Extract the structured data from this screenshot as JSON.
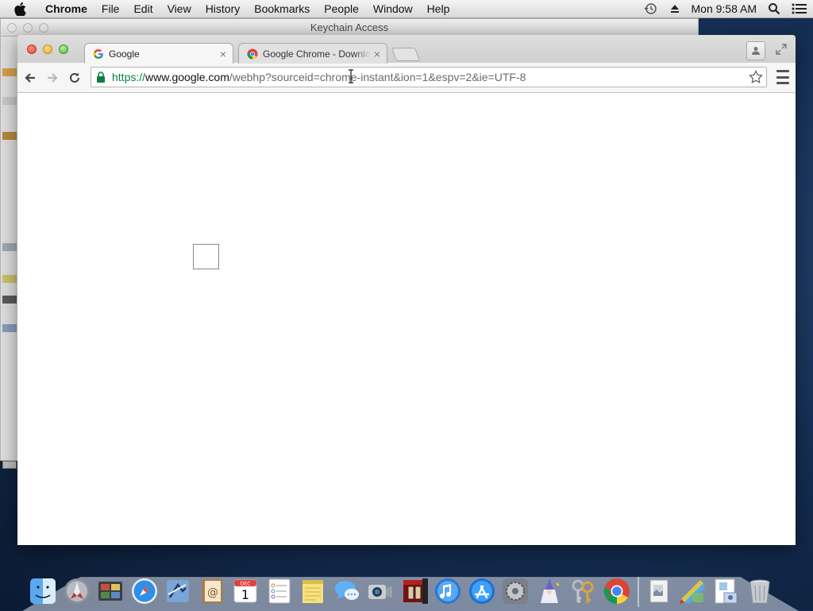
{
  "menubar": {
    "app_name": "Chrome",
    "items": [
      "File",
      "Edit",
      "View",
      "History",
      "Bookmarks",
      "People",
      "Window",
      "Help"
    ],
    "clock": "Mon 9:58 AM"
  },
  "background_window": {
    "title": "Keychain Access"
  },
  "browser": {
    "tabs": [
      {
        "title": "Google",
        "favicon": "google-favicon",
        "active": true
      },
      {
        "title": "Google Chrome - Download",
        "favicon": "chrome-favicon",
        "active": false
      }
    ],
    "tab_close_glyph": "×",
    "omnibox": {
      "scheme": "https://",
      "host": "www.google.com",
      "path": "/webhp?sourceid=chrome-instant&ion=1&espv=2&ie=UTF-8"
    }
  },
  "dock": {
    "apps": [
      "finder",
      "launchpad",
      "photo-browser",
      "safari",
      "mail",
      "contacts",
      "calendar",
      "reminders",
      "notes",
      "messages",
      "facetime",
      "photo-booth",
      "itunes",
      "app-store",
      "system-preferences",
      "wizard",
      "keychain",
      "chrome"
    ],
    "stack_items": [
      "preview",
      "directory-utility",
      "documents"
    ],
    "calendar_day": "1",
    "calendar_month": "DEC"
  },
  "colors": {
    "secure_scheme": "#0b8043",
    "desktop": "#163056"
  }
}
